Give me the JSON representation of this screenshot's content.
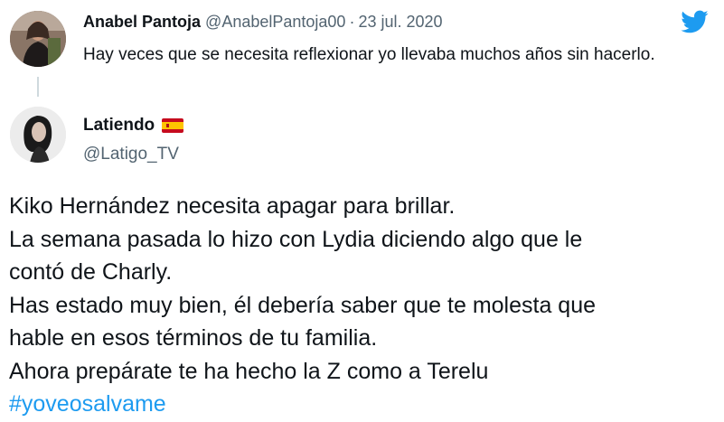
{
  "quoted_tweet": {
    "author_name": "Anabel Pantoja",
    "handle": "@AnabelPantoja00",
    "separator": "·",
    "date": "23 jul. 2020",
    "text": "Hay veces que se necesita reflexionar yo llevaba muchos años sin hacerlo."
  },
  "reply": {
    "author_name": "Latiendo",
    "handle": "@Latigo_TV",
    "lines": [
      "Kiko Hernández necesita apagar para brillar.",
      "La semana pasada lo hizo con Lydia diciendo algo que le",
      "contó de Charly.",
      "Has estado muy bien, él debería saber que te molesta que",
      "hable en esos términos de tu familia.",
      "Ahora prepárate te ha hecho la Z como a Terelu"
    ],
    "hashtag": "#yoveosalvame"
  },
  "colors": {
    "twitter_blue": "#1d9bf0",
    "text": "#0f1419",
    "secondary_text": "#536471"
  },
  "icons": [
    "twitter-bird-icon",
    "spain-flag-icon"
  ]
}
